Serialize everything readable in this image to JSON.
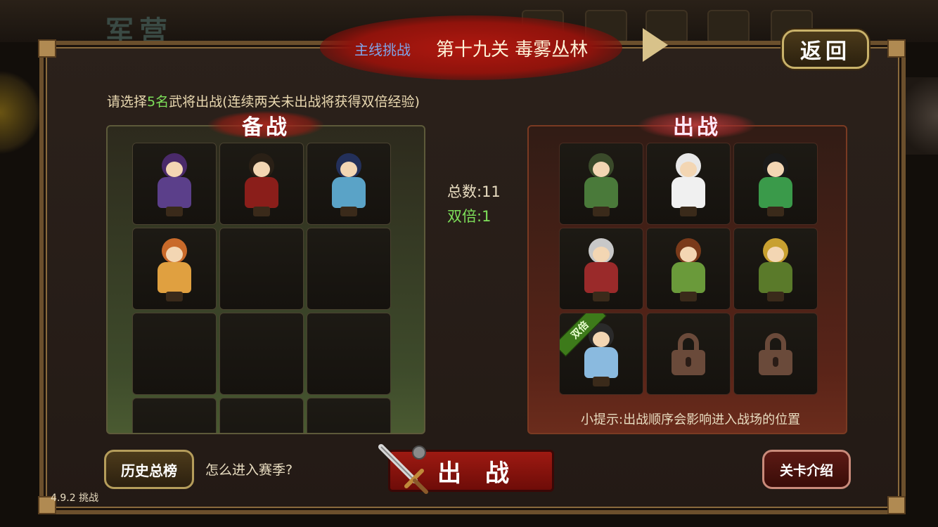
{
  "background": {
    "title": "军营"
  },
  "header": {
    "mode": "主线挑战",
    "stage": "第十九关 毒雾丛林",
    "return_label": "返回"
  },
  "instruction": {
    "prefix": "请选择",
    "count": "5名",
    "suffix": "武将出战(连续两关未出战将获得双倍经验)"
  },
  "reserve": {
    "label": "备战",
    "heroes": [
      {
        "hair": "#4a2a6a",
        "outfit": "#5b3f8a"
      },
      {
        "hair": "#2a2016",
        "outfit": "#8a1e1a"
      },
      {
        "hair": "#23305a",
        "outfit": "#5aa3c7"
      },
      {
        "hair": "#c96a2a",
        "outfit": "#e0a040"
      }
    ],
    "empty_slots": 8
  },
  "stats": {
    "total": "总数:11",
    "double": "双倍:1"
  },
  "battle": {
    "label": "出战",
    "heroes": [
      {
        "hair": "#3a4a2a",
        "outfit": "#4a7a3a"
      },
      {
        "hair": "#e8e8e8",
        "outfit": "#f0f0f0"
      },
      {
        "hair": "#1a1a1a",
        "outfit": "#3a9a4a"
      },
      {
        "hair": "#c8c8c8",
        "outfit": "#9a2a2a"
      },
      {
        "hair": "#7a3a1a",
        "outfit": "#6a9a3a"
      },
      {
        "hair": "#c8a030",
        "outfit": "#5a7a2a"
      },
      {
        "hair": "#2a2a2a",
        "outfit": "#8abadf",
        "badge": "双倍"
      }
    ],
    "locked_slots": 2,
    "tip": "小提示:出战顺序会影响进入战场的位置"
  },
  "footer": {
    "history_label": "历史总榜",
    "season_link": "怎么进入赛季?",
    "fight_label": "出战",
    "stage_info_label": "关卡介绍",
    "version": "4.9.2 挑战"
  },
  "colors": {
    "highlight_green": "#7ee05a",
    "mode_blue": "#7fa4e8",
    "banner_red": "#a3180f"
  },
  "icons": [
    "play-arrow-icon",
    "sword-icon",
    "lock-icon"
  ]
}
